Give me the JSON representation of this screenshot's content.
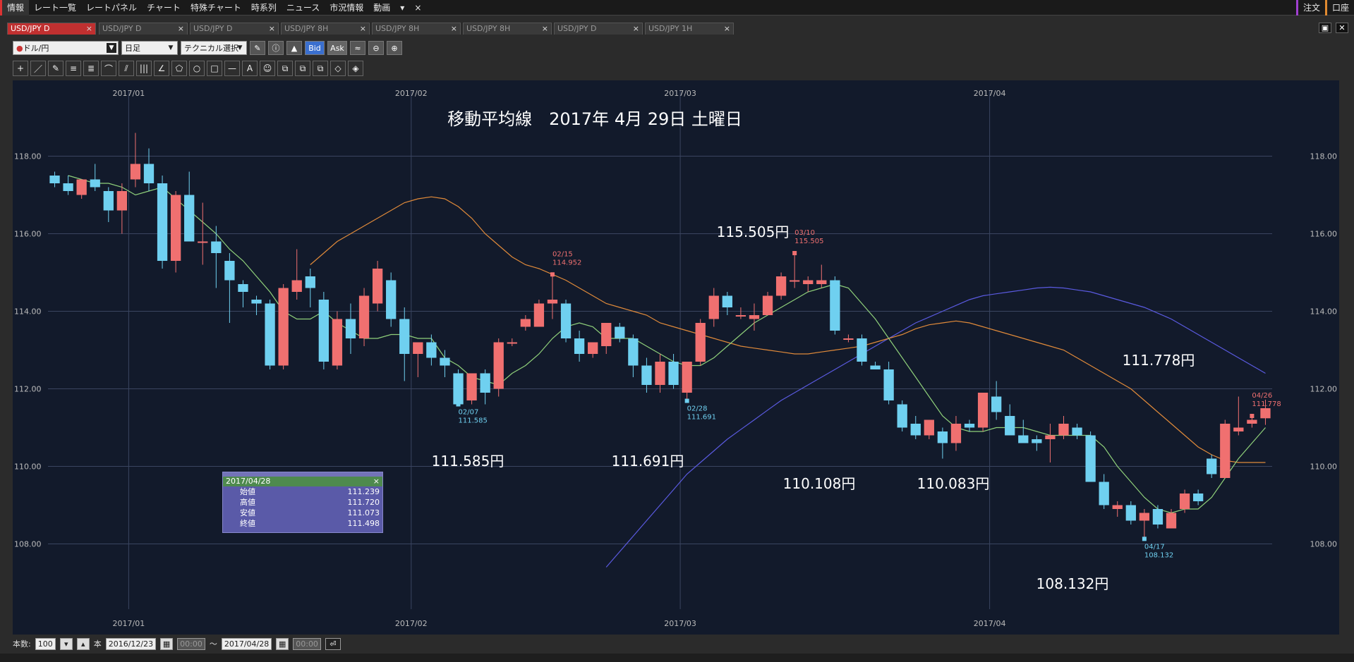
{
  "menubar": {
    "items": [
      "情報",
      "レート一覧",
      "レートパネル",
      "チャート",
      "特殊チャート",
      "時系列",
      "ニュース",
      "市況情報",
      "動画",
      "▾",
      "×"
    ],
    "right": [
      "注文",
      "口座"
    ]
  },
  "tabs": [
    "USD/JPY D",
    "USD/JPY D",
    "USD/JPY D",
    "USD/JPY 8H",
    "USD/JPY 8H",
    "USD/JPY 8H",
    "USD/JPY D",
    "USD/JPY 1H"
  ],
  "toolbar": {
    "currency_select": "ドル/円",
    "period_select": "日足",
    "technical_select": "テクニカル選択",
    "bid_label": "Bid",
    "ask_label": "Ask"
  },
  "drawing_tools": [
    "+",
    "／",
    "✎",
    "≡",
    "≣",
    "⌒",
    "⫽",
    "|||",
    "∠",
    "⬠",
    "○",
    "□",
    "—",
    "A",
    "☺",
    "⧉",
    "⧉",
    "⧉",
    "◇",
    "◈"
  ],
  "chart_data": {
    "type": "candlestick",
    "title": "移動平均線　2017年 4月 29日 土曜日",
    "x_month_labels": [
      "2017/01",
      "2017/02",
      "2017/03",
      "2017/04"
    ],
    "y_ticks": [
      "118.00",
      "116.00",
      "114.00",
      "112.00",
      "110.00",
      "108.00"
    ],
    "ylim": [
      106.5,
      119.5
    ],
    "grid": true,
    "colors": {
      "up": "#f07070",
      "down": "#6fd0f0",
      "ma_short": "#8fd07a",
      "ma_mid": "#e08a3a",
      "ma_long": "#5a5ae0",
      "background": "#121a2b"
    },
    "candles": [
      {
        "o": 117.5,
        "h": 117.6,
        "l": 117.2,
        "c": 117.3
      },
      {
        "o": 117.3,
        "h": 117.5,
        "l": 117.0,
        "c": 117.1
      },
      {
        "o": 117.0,
        "h": 117.4,
        "l": 116.9,
        "c": 117.4
      },
      {
        "o": 117.4,
        "h": 117.8,
        "l": 117.1,
        "c": 117.2
      },
      {
        "o": 117.1,
        "h": 117.2,
        "l": 116.3,
        "c": 116.6
      },
      {
        "o": 116.6,
        "h": 117.3,
        "l": 116.0,
        "c": 117.1
      },
      {
        "o": 117.4,
        "h": 118.6,
        "l": 117.2,
        "c": 117.8
      },
      {
        "o": 117.8,
        "h": 118.2,
        "l": 117.1,
        "c": 117.3
      },
      {
        "o": 117.3,
        "h": 117.5,
        "l": 115.1,
        "c": 115.3
      },
      {
        "o": 115.3,
        "h": 117.1,
        "l": 115.0,
        "c": 117.0
      },
      {
        "o": 117.0,
        "h": 117.6,
        "l": 115.9,
        "c": 115.8
      },
      {
        "o": 115.8,
        "h": 116.8,
        "l": 115.2,
        "c": 115.8
      },
      {
        "o": 115.8,
        "h": 116.2,
        "l": 114.6,
        "c": 115.5
      },
      {
        "o": 115.3,
        "h": 115.5,
        "l": 113.7,
        "c": 114.8
      },
      {
        "o": 114.7,
        "h": 114.8,
        "l": 114.1,
        "c": 114.5
      },
      {
        "o": 114.3,
        "h": 114.4,
        "l": 113.9,
        "c": 114.2
      },
      {
        "o": 114.2,
        "h": 114.3,
        "l": 112.5,
        "c": 112.6
      },
      {
        "o": 112.6,
        "h": 114.7,
        "l": 112.5,
        "c": 114.6
      },
      {
        "o": 114.5,
        "h": 115.6,
        "l": 114.3,
        "c": 114.8
      },
      {
        "o": 114.9,
        "h": 115.1,
        "l": 114.1,
        "c": 114.6
      },
      {
        "o": 114.3,
        "h": 114.5,
        "l": 112.5,
        "c": 112.7
      },
      {
        "o": 112.6,
        "h": 114.0,
        "l": 112.5,
        "c": 113.8
      },
      {
        "o": 113.8,
        "h": 114.2,
        "l": 112.9,
        "c": 113.3
      },
      {
        "o": 113.3,
        "h": 114.6,
        "l": 113.1,
        "c": 114.4
      },
      {
        "o": 114.2,
        "h": 115.3,
        "l": 114.0,
        "c": 115.1
      },
      {
        "o": 114.8,
        "h": 115.0,
        "l": 113.6,
        "c": 113.8
      },
      {
        "o": 113.8,
        "h": 114.1,
        "l": 112.2,
        "c": 112.9
      },
      {
        "o": 112.9,
        "h": 113.2,
        "l": 112.3,
        "c": 113.2
      },
      {
        "o": 113.2,
        "h": 113.4,
        "l": 112.6,
        "c": 112.8
      },
      {
        "o": 112.8,
        "h": 113.0,
        "l": 112.3,
        "c": 112.6
      },
      {
        "o": 112.4,
        "h": 112.5,
        "l": 111.6,
        "c": 111.6
      },
      {
        "o": 111.7,
        "h": 112.4,
        "l": 111.6,
        "c": 112.4
      },
      {
        "o": 112.4,
        "h": 112.5,
        "l": 111.6,
        "c": 111.9
      },
      {
        "o": 112.0,
        "h": 113.3,
        "l": 111.8,
        "c": 113.2
      },
      {
        "o": 113.2,
        "h": 113.3,
        "l": 113.1,
        "c": 113.2
      },
      {
        "o": 113.6,
        "h": 113.9,
        "l": 113.5,
        "c": 113.8
      },
      {
        "o": 113.6,
        "h": 114.3,
        "l": 113.6,
        "c": 114.2
      },
      {
        "o": 114.2,
        "h": 114.95,
        "l": 113.8,
        "c": 114.3
      },
      {
        "o": 114.2,
        "h": 114.3,
        "l": 113.2,
        "c": 113.3
      },
      {
        "o": 113.3,
        "h": 113.5,
        "l": 112.7,
        "c": 112.9
      },
      {
        "o": 112.9,
        "h": 113.2,
        "l": 112.8,
        "c": 113.2
      },
      {
        "o": 113.1,
        "h": 113.7,
        "l": 112.9,
        "c": 113.7
      },
      {
        "o": 113.6,
        "h": 113.7,
        "l": 113.2,
        "c": 113.3
      },
      {
        "o": 113.3,
        "h": 113.4,
        "l": 112.3,
        "c": 112.6
      },
      {
        "o": 112.6,
        "h": 112.8,
        "l": 111.9,
        "c": 112.1
      },
      {
        "o": 112.1,
        "h": 112.9,
        "l": 111.9,
        "c": 112.7
      },
      {
        "o": 112.7,
        "h": 112.9,
        "l": 112.0,
        "c": 112.1
      },
      {
        "o": 111.9,
        "h": 112.6,
        "l": 111.69,
        "c": 112.7
      },
      {
        "o": 112.7,
        "h": 113.8,
        "l": 112.6,
        "c": 113.7
      },
      {
        "o": 113.8,
        "h": 114.6,
        "l": 113.6,
        "c": 114.4
      },
      {
        "o": 114.4,
        "h": 114.5,
        "l": 113.9,
        "c": 114.1
      },
      {
        "o": 113.9,
        "h": 114.1,
        "l": 113.8,
        "c": 113.9
      },
      {
        "o": 113.8,
        "h": 114.2,
        "l": 113.5,
        "c": 113.9
      },
      {
        "o": 113.9,
        "h": 114.5,
        "l": 113.9,
        "c": 114.4
      },
      {
        "o": 114.4,
        "h": 115.0,
        "l": 114.3,
        "c": 114.9
      },
      {
        "o": 114.8,
        "h": 115.5,
        "l": 114.6,
        "c": 114.8
      },
      {
        "o": 114.7,
        "h": 114.9,
        "l": 114.5,
        "c": 114.8
      },
      {
        "o": 114.7,
        "h": 115.2,
        "l": 114.6,
        "c": 114.8
      },
      {
        "o": 114.8,
        "h": 114.9,
        "l": 113.4,
        "c": 113.5
      },
      {
        "o": 113.3,
        "h": 113.4,
        "l": 113.2,
        "c": 113.3
      },
      {
        "o": 113.3,
        "h": 113.4,
        "l": 112.6,
        "c": 112.7
      },
      {
        "o": 112.6,
        "h": 112.7,
        "l": 112.5,
        "c": 112.5
      },
      {
        "o": 112.5,
        "h": 112.7,
        "l": 111.6,
        "c": 111.7
      },
      {
        "o": 111.6,
        "h": 111.7,
        "l": 110.9,
        "c": 111.0
      },
      {
        "o": 111.1,
        "h": 111.3,
        "l": 110.7,
        "c": 110.8
      },
      {
        "o": 110.8,
        "h": 111.2,
        "l": 110.7,
        "c": 111.2
      },
      {
        "o": 110.9,
        "h": 111.0,
        "l": 110.2,
        "c": 110.6
      },
      {
        "o": 110.6,
        "h": 111.3,
        "l": 110.4,
        "c": 111.1
      },
      {
        "o": 111.1,
        "h": 111.2,
        "l": 110.9,
        "c": 111.0
      },
      {
        "o": 111.0,
        "h": 111.9,
        "l": 110.9,
        "c": 111.9
      },
      {
        "o": 111.8,
        "h": 112.2,
        "l": 111.2,
        "c": 111.4
      },
      {
        "o": 111.3,
        "h": 111.6,
        "l": 110.8,
        "c": 110.8
      },
      {
        "o": 110.8,
        "h": 111.2,
        "l": 110.6,
        "c": 110.6
      },
      {
        "o": 110.7,
        "h": 110.8,
        "l": 110.4,
        "c": 110.6
      },
      {
        "o": 110.7,
        "h": 111.1,
        "l": 110.1,
        "c": 110.8
      },
      {
        "o": 110.8,
        "h": 111.3,
        "l": 110.7,
        "c": 111.1
      },
      {
        "o": 111.0,
        "h": 111.1,
        "l": 110.7,
        "c": 110.8
      },
      {
        "o": 110.8,
        "h": 110.9,
        "l": 109.6,
        "c": 109.6
      },
      {
        "o": 109.6,
        "h": 109.8,
        "l": 108.9,
        "c": 109.0
      },
      {
        "o": 108.9,
        "h": 109.1,
        "l": 108.7,
        "c": 109.0
      },
      {
        "o": 109.0,
        "h": 109.1,
        "l": 108.5,
        "c": 108.6
      },
      {
        "o": 108.6,
        "h": 108.9,
        "l": 108.13,
        "c": 108.8
      },
      {
        "o": 108.9,
        "h": 109.0,
        "l": 108.4,
        "c": 108.5
      },
      {
        "o": 108.4,
        "h": 108.9,
        "l": 108.4,
        "c": 108.8
      },
      {
        "o": 108.9,
        "h": 109.4,
        "l": 108.8,
        "c": 109.3
      },
      {
        "o": 109.3,
        "h": 109.4,
        "l": 109.0,
        "c": 109.1
      },
      {
        "o": 110.2,
        "h": 110.3,
        "l": 109.7,
        "c": 109.8
      },
      {
        "o": 109.7,
        "h": 111.2,
        "l": 109.7,
        "c": 111.1
      },
      {
        "o": 110.9,
        "h": 111.8,
        "l": 110.8,
        "c": 111.0
      },
      {
        "o": 111.1,
        "h": 111.3,
        "l": 111.0,
        "c": 111.2
      },
      {
        "o": 111.24,
        "h": 111.72,
        "l": 111.07,
        "c": 111.5
      }
    ],
    "ma_short": [
      117.5,
      117.4,
      117.3,
      117.3,
      117.2,
      117.0,
      117.1,
      117.2,
      116.9,
      116.6,
      116.3,
      116.0,
      115.6,
      115.3,
      114.9,
      114.5,
      114.0,
      113.8,
      113.8,
      114.0,
      113.7,
      113.5,
      113.3,
      113.3,
      113.4,
      113.4,
      113.3,
      113.3,
      112.8,
      112.6,
      112.3,
      112.2,
      112.1,
      112.4,
      112.6,
      112.9,
      113.3,
      113.6,
      113.7,
      113.6,
      113.3,
      113.3,
      113.3,
      113.1,
      112.9,
      112.7,
      112.6,
      112.6,
      112.8,
      113.1,
      113.4,
      113.7,
      113.9,
      114.1,
      114.3,
      114.5,
      114.6,
      114.7,
      114.6,
      114.2,
      113.8,
      113.3,
      112.8,
      112.3,
      111.8,
      111.3,
      111.0,
      110.9,
      110.9,
      111.0,
      111.0,
      111.0,
      110.9,
      110.8,
      110.8,
      110.8,
      110.8,
      110.5,
      110.0,
      109.6,
      109.2,
      108.9,
      108.8,
      108.9,
      108.9,
      109.2,
      109.7,
      110.2,
      110.6,
      111.0
    ],
    "ma_mid": [
      115.2,
      115.5,
      115.8,
      116.0,
      116.2,
      116.4,
      116.6,
      116.8,
      116.9,
      116.95,
      116.9,
      116.7,
      116.4,
      116.0,
      115.7,
      115.4,
      115.2,
      115.1,
      114.95,
      114.8,
      114.6,
      114.4,
      114.2,
      114.1,
      114.0,
      113.9,
      113.7,
      113.6,
      113.5,
      113.4,
      113.3,
      113.2,
      113.1,
      113.05,
      113.0,
      112.95,
      112.9,
      112.9,
      112.95,
      113.0,
      113.05,
      113.1,
      113.2,
      113.3,
      113.4,
      113.55,
      113.65,
      113.7,
      113.75,
      113.7,
      113.6,
      113.5,
      113.4,
      113.3,
      113.2,
      113.1,
      113.0,
      112.8,
      112.6,
      112.4,
      112.2,
      112.0,
      111.7,
      111.4,
      111.1,
      110.8,
      110.5,
      110.3,
      110.15,
      110.1,
      110.1,
      110.1
    ],
    "ma_long": [
      107.4,
      107.8,
      108.2,
      108.6,
      109.0,
      109.4,
      109.8,
      110.1,
      110.4,
      110.7,
      110.95,
      111.2,
      111.45,
      111.7,
      111.9,
      112.1,
      112.3,
      112.5,
      112.7,
      112.9,
      113.1,
      113.3,
      113.5,
      113.7,
      113.85,
      114.0,
      114.15,
      114.3,
      114.4,
      114.45,
      114.5,
      114.55,
      114.6,
      114.62,
      114.6,
      114.55,
      114.5,
      114.4,
      114.3,
      114.2,
      114.1,
      113.95,
      113.8,
      113.6,
      113.4,
      113.2,
      113.0,
      112.8,
      112.6,
      112.4
    ],
    "marker_labels": [
      {
        "date": "02/15",
        "value": "114.952",
        "kind": "high"
      },
      {
        "date": "02/07",
        "value": "111.585",
        "kind": "low"
      },
      {
        "date": "03/10",
        "value": "115.505",
        "kind": "high"
      },
      {
        "date": "02/28",
        "value": "111.691",
        "kind": "low"
      },
      {
        "date": "04/17",
        "value": "108.132",
        "kind": "low"
      },
      {
        "date": "04/26",
        "value": "111.778",
        "kind": "high"
      }
    ],
    "annotations": [
      "115.505円",
      "111.585円",
      "111.691円",
      "110.108円",
      "110.083円",
      "108.132円",
      "111.778円"
    ]
  },
  "info_panel": {
    "date": "2017/04/28",
    "rows": [
      {
        "label": "始値",
        "value": "111.239"
      },
      {
        "label": "高値",
        "value": "111.720"
      },
      {
        "label": "安値",
        "value": "111.073"
      },
      {
        "label": "終値",
        "value": "111.498"
      }
    ]
  },
  "footer": {
    "count_label": "本数:",
    "count_value": "100",
    "count_unit": "本",
    "start_date": "2016/12/23",
    "start_time": "00:00",
    "tilde": "〜",
    "end_date": "2017/04/28",
    "end_time": "00:00"
  }
}
